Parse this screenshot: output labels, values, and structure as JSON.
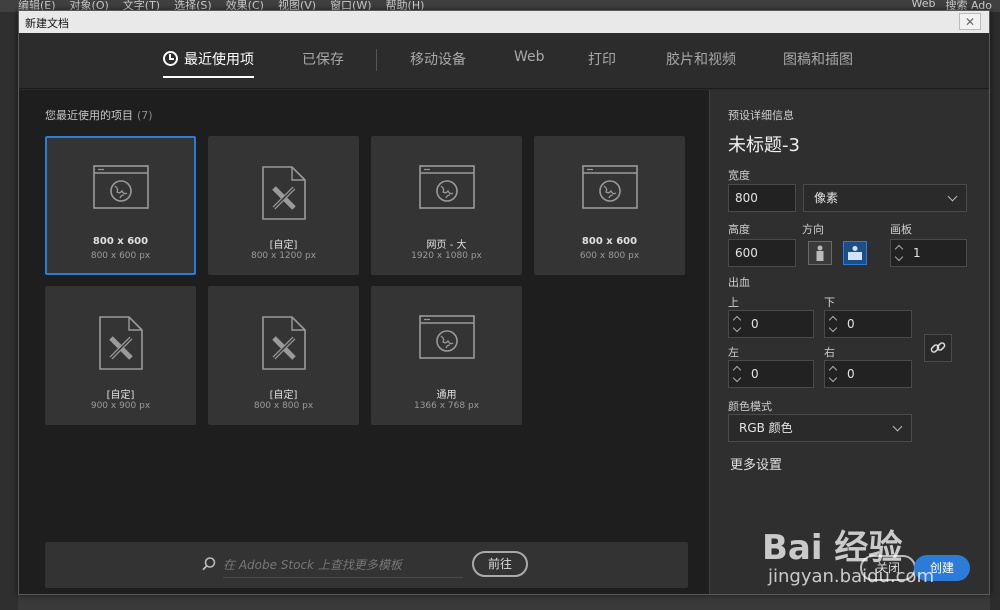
{
  "background_app": {
    "menu": [
      "编辑(E)",
      "对象(O)",
      "文字(T)",
      "选择(S)",
      "效果(C)",
      "视图(V)",
      "窗口(W)",
      "帮助(H)"
    ],
    "right": [
      "Web",
      "搜索 Ado"
    ]
  },
  "dialog": {
    "title": "新建文档",
    "close_glyph": "✕"
  },
  "tabs": [
    {
      "label": "最近使用项",
      "active": true
    },
    {
      "label": "已保存"
    },
    {
      "label": "移动设备"
    },
    {
      "label": "Web"
    },
    {
      "label": "打印"
    },
    {
      "label": "胶片和视频"
    },
    {
      "label": "图稿和插图"
    }
  ],
  "recent": {
    "title": "您最近使用的项目",
    "count": "(7)",
    "items": [
      {
        "name": "800 x 600",
        "size": "800 x 600 px",
        "icon": "web-page-icon",
        "selected": true,
        "bold": true
      },
      {
        "name": "[自定]",
        "size": "800 x 1200 px",
        "icon": "document-pencil-icon"
      },
      {
        "name": "网页 - 大",
        "size": "1920 x 1080 px",
        "icon": "web-page-icon"
      },
      {
        "name": "800 x 600",
        "size": "600 x 800 px",
        "icon": "web-page-icon",
        "bold": true
      },
      {
        "name": "[自定]",
        "size": "900 x 900 px",
        "icon": "document-pencil-icon"
      },
      {
        "name": "[自定]",
        "size": "800 x 800 px",
        "icon": "document-pencil-icon"
      },
      {
        "name": "通用",
        "size": "1366 x 768 px",
        "icon": "web-page-icon"
      }
    ]
  },
  "stock": {
    "placeholder": "在 Adobe Stock 上查找更多模板",
    "go_label": "前往"
  },
  "preset": {
    "section_title": "预设详细信息",
    "doc_name": "未标题-3",
    "width_label": "宽度",
    "width_value": "800",
    "unit": "像素",
    "height_label": "高度",
    "height_value": "600",
    "orientation_label": "方向",
    "artboard_label": "画板",
    "artboard_value": "1",
    "bleed_label": "出血",
    "top_label": "上",
    "top_value": "0",
    "bottom_label": "下",
    "bottom_value": "0",
    "left_label": "左",
    "left_value": "0",
    "right_label": "右",
    "right_value": "0",
    "color_mode_label": "颜色模式",
    "color_mode": "RGB 颜色",
    "more_settings": "更多设置",
    "close_label": "关闭",
    "create_label": "创建"
  },
  "watermark": {
    "text": "Bai 经验",
    "url": "jingyan.baidu.com"
  },
  "colors": {
    "accent": "#2d7bd8"
  }
}
